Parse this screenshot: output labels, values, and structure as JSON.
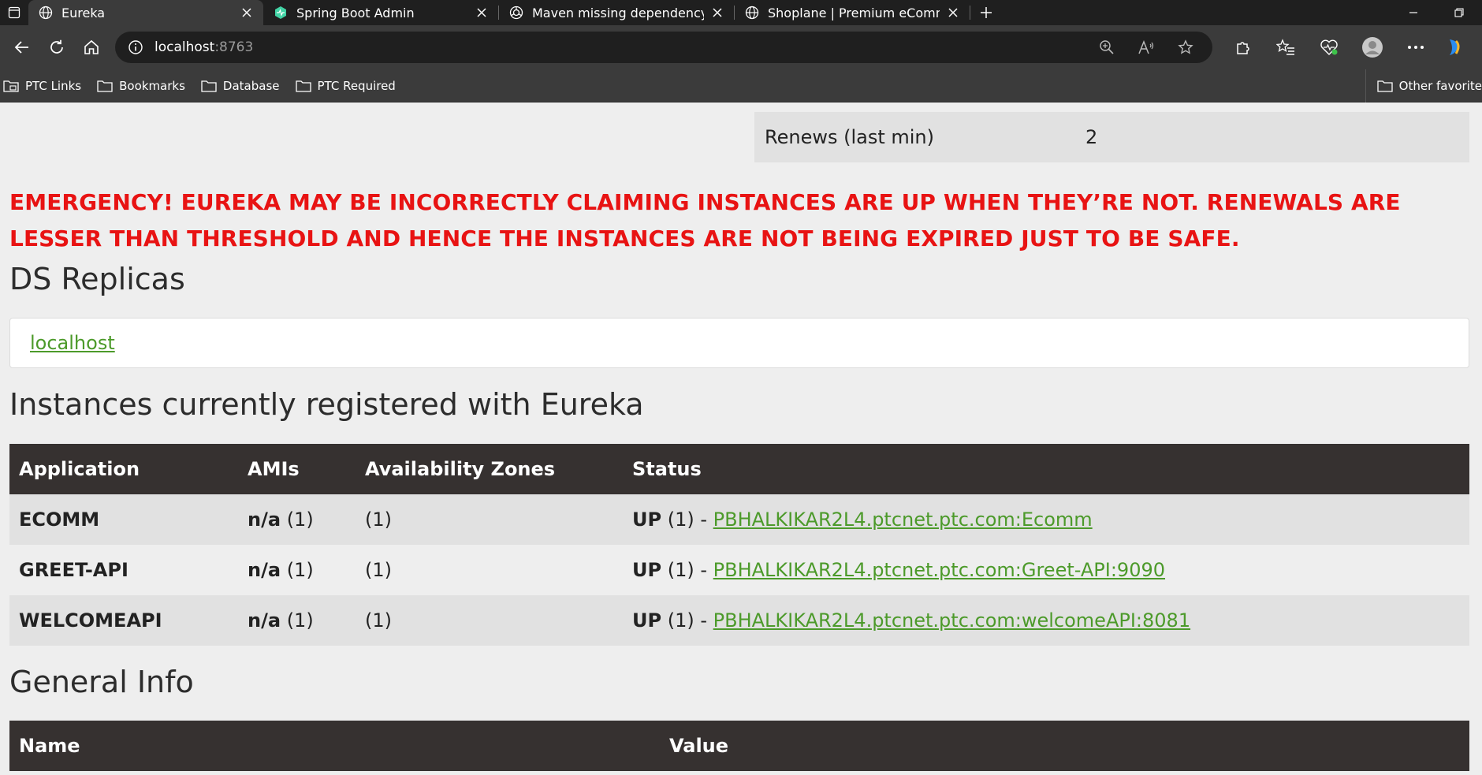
{
  "browser": {
    "tabs": [
      {
        "title": "Eureka",
        "active": true,
        "icon": "globe-icon"
      },
      {
        "title": "Spring Boot Admin",
        "active": false,
        "icon": "spring-boot-admin-icon"
      },
      {
        "title": "Maven missing dependency versio",
        "active": false,
        "icon": "openai-icon"
      },
      {
        "title": "Shoplane | Premium eCommerce",
        "active": false,
        "icon": "globe-icon"
      }
    ],
    "address": {
      "host": "localhost",
      "port": ":8763"
    },
    "bookmarks": [
      "PTC Links",
      "Bookmarks",
      "Database",
      "PTC Required"
    ],
    "other_favorites": "Other favorite"
  },
  "stats": {
    "renews_label": "Renews (last min)",
    "renews_value": "2"
  },
  "emergency": "EMERGENCY! EUREKA MAY BE INCORRECTLY CLAIMING INSTANCES ARE UP WHEN THEY’RE NOT. RENEWALS ARE LESSER THAN THRESHOLD AND HENCE THE INSTANCES ARE NOT BEING EXPIRED JUST TO BE SAFE.",
  "replicas": {
    "heading": "DS Replicas",
    "link": "localhost"
  },
  "instances": {
    "heading": "Instances currently registered with Eureka",
    "columns": [
      "Application",
      "AMIs",
      "Availability Zones",
      "Status"
    ],
    "rows": [
      {
        "app": "ECOMM",
        "ami": "n/a",
        "ami_count": "(1)",
        "zones": "(1)",
        "status": "UP",
        "status_count": "(1) -",
        "link": "PBHALKIKAR2L4.ptcnet.ptc.com:Ecomm"
      },
      {
        "app": "GREET-API",
        "ami": "n/a",
        "ami_count": "(1)",
        "zones": "(1)",
        "status": "UP",
        "status_count": "(1) -",
        "link": "PBHALKIKAR2L4.ptcnet.ptc.com:Greet-API:9090"
      },
      {
        "app": "WELCOMEAPI",
        "ami": "n/a",
        "ami_count": "(1)",
        "zones": "(1)",
        "status": "UP",
        "status_count": "(1) -",
        "link": "PBHALKIKAR2L4.ptcnet.ptc.com:welcomeAPI:8081"
      }
    ]
  },
  "general": {
    "heading": "General Info",
    "columns": [
      "Name",
      "Value"
    ]
  },
  "colors": {
    "emergency": "#e81313",
    "link": "#4c9a2a",
    "table_header": "#363130"
  }
}
